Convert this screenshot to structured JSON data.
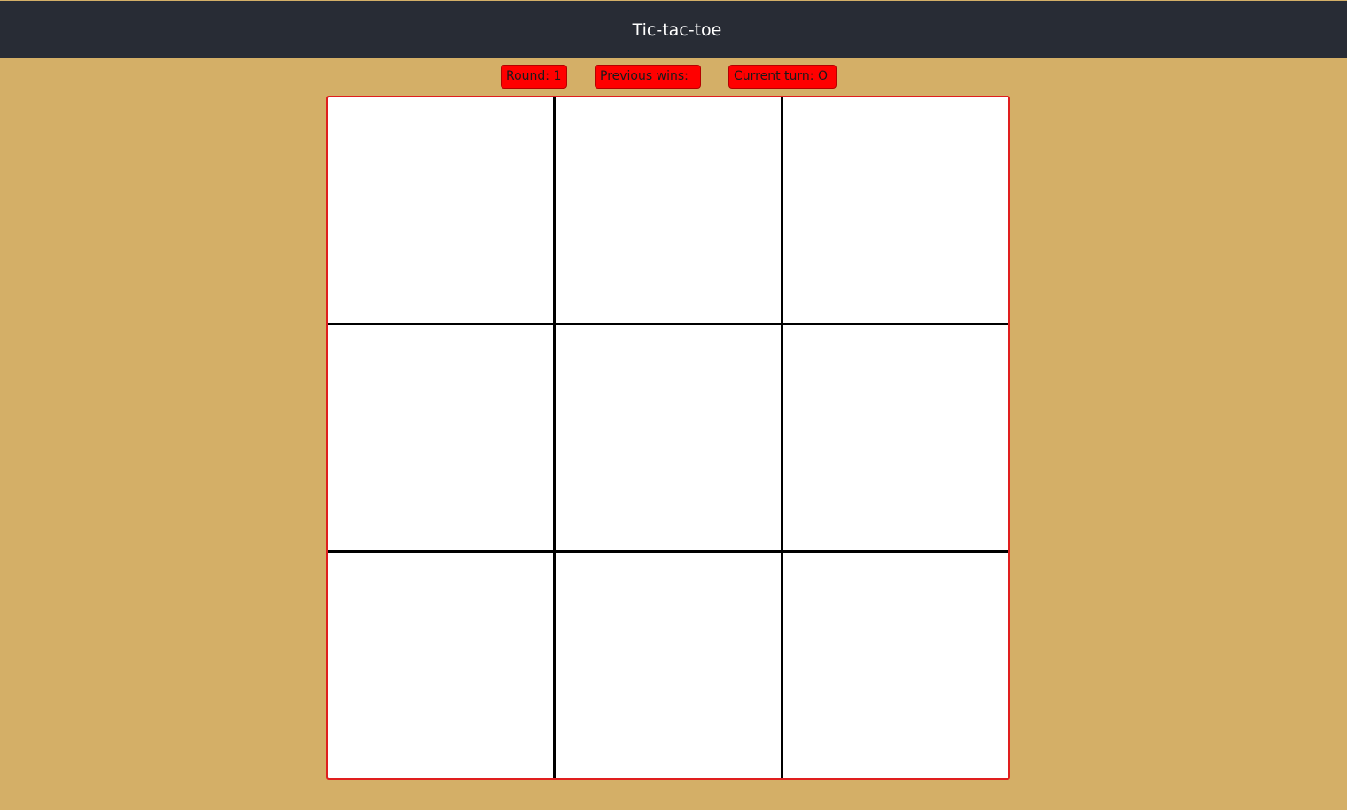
{
  "header": {
    "title": "Tic-tac-toe"
  },
  "status": {
    "round": "Round: 1",
    "previous_wins": "Previous wins:",
    "current_turn": "Current turn: O"
  },
  "board": {
    "cells": [
      "",
      "",
      "",
      "",
      "",
      "",
      "",
      "",
      ""
    ]
  },
  "colors": {
    "page_background": "#d4af67",
    "header_background": "#282c35",
    "badge_background": "#ff0000",
    "board_border": "#e01e1e",
    "grid_lines": "#000000",
    "cell_background": "#ffffff"
  }
}
